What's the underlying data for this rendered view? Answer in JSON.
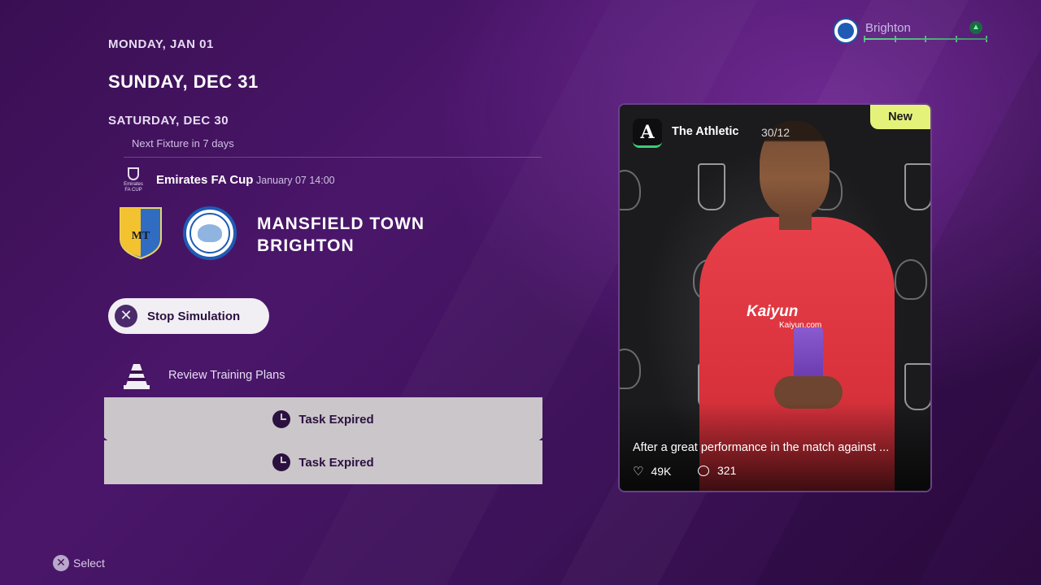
{
  "header": {
    "club": "Brighton"
  },
  "dates": {
    "day_1": "MONDAY, JAN 01",
    "day_2": "SUNDAY, DEC 31",
    "day_3": "SATURDAY, DEC 30",
    "next_fixture": "Next Fixture in 7 days"
  },
  "fixture": {
    "competition": "Emirates FA Cup",
    "competition_logo_text": "Emirates FA CUP",
    "kickoff": "January 07 14:00",
    "home_team": "MANSFIELD TOWN",
    "away_team": "BRIGHTON",
    "home_crest_icon": "mansfield-crest-icon",
    "away_crest_icon": "brighton-crest-icon"
  },
  "actions": {
    "stop_simulation": "Stop Simulation",
    "review_training": "Review Training Plans"
  },
  "tasks": [
    {
      "label": "Task Expired",
      "icon": "clock-icon"
    },
    {
      "label": "Task Expired",
      "icon": "clock-icon"
    }
  ],
  "news": {
    "source": "The Athletic",
    "source_logo": "A",
    "date": "30/12",
    "badge": "New",
    "badge_color": "#e5f27a",
    "headline": "After a great performance in the match against ...",
    "likes": "49K",
    "comments": "321",
    "sponsor": "Kaiyun",
    "sponsor_sub": "Kaiyun.com"
  },
  "footer": {
    "hint_icon": "✕",
    "hint_label": "Select"
  },
  "colors": {
    "accent_green": "#3ccc7a",
    "task_bg": "#cbc6ca",
    "button_bg": "#f1eef4"
  }
}
